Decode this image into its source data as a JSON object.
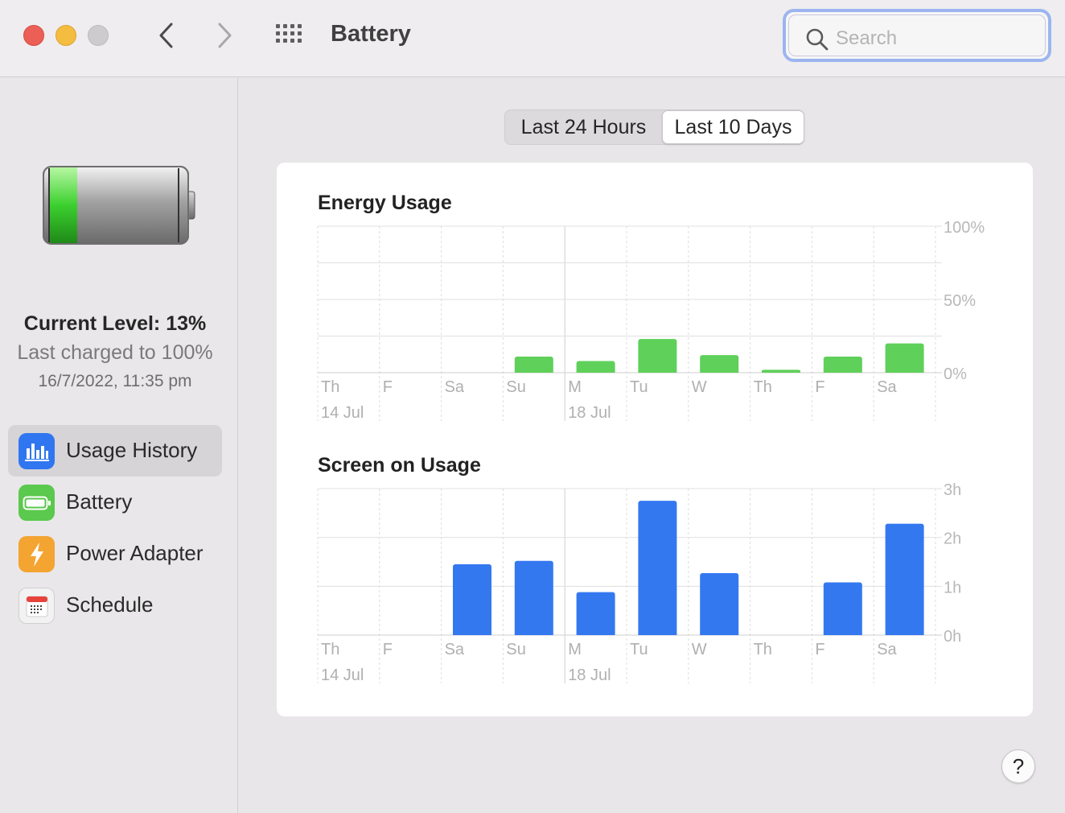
{
  "window": {
    "title": "Battery",
    "search_placeholder": "Search"
  },
  "sidebar": {
    "current_level": "Current Level: 13%",
    "last_charged": "Last charged to 100%",
    "charged_time": "16/7/2022, 11:35 pm",
    "items": [
      {
        "label": "Usage History",
        "icon": "usage-history-icon",
        "color": "#2f76f0"
      },
      {
        "label": "Battery",
        "icon": "battery-icon",
        "color": "#5bc84e"
      },
      {
        "label": "Power Adapter",
        "icon": "power-adapter-icon",
        "color": "#f3a431"
      },
      {
        "label": "Schedule",
        "icon": "schedule-icon",
        "color": "#f2f2f2"
      }
    ]
  },
  "tabs": [
    "Last 24 Hours",
    "Last 10 Days"
  ],
  "help_label": "?",
  "chart_data": [
    {
      "type": "bar",
      "title": "Energy Usage",
      "categories": [
        "Th",
        "F",
        "Sa",
        "Su",
        "M",
        "Tu",
        "W",
        "Th",
        "F",
        "Sa"
      ],
      "date_labels": [
        "14 Jul",
        "",
        "",
        "",
        "18 Jul",
        "",
        "",
        "",
        "",
        ""
      ],
      "values": [
        0,
        0,
        0,
        11,
        8,
        23,
        12,
        2,
        11,
        20
      ],
      "yticks": [
        "100%",
        "50%",
        "0%"
      ],
      "ylim": [
        0,
        100
      ],
      "color": "#5fd05a"
    },
    {
      "type": "bar",
      "title": "Screen on Usage",
      "categories": [
        "Th",
        "F",
        "Sa",
        "Su",
        "M",
        "Tu",
        "W",
        "Th",
        "F",
        "Sa"
      ],
      "date_labels": [
        "14 Jul",
        "",
        "",
        "",
        "18 Jul",
        "",
        "",
        "",
        "",
        ""
      ],
      "values": [
        0,
        0,
        1.45,
        1.52,
        0.88,
        2.75,
        1.27,
        0,
        1.08,
        2.28
      ],
      "yticks": [
        "3h",
        "2h",
        "1h",
        "0h"
      ],
      "ylim": [
        0,
        3
      ],
      "color": "#3478f0"
    }
  ]
}
